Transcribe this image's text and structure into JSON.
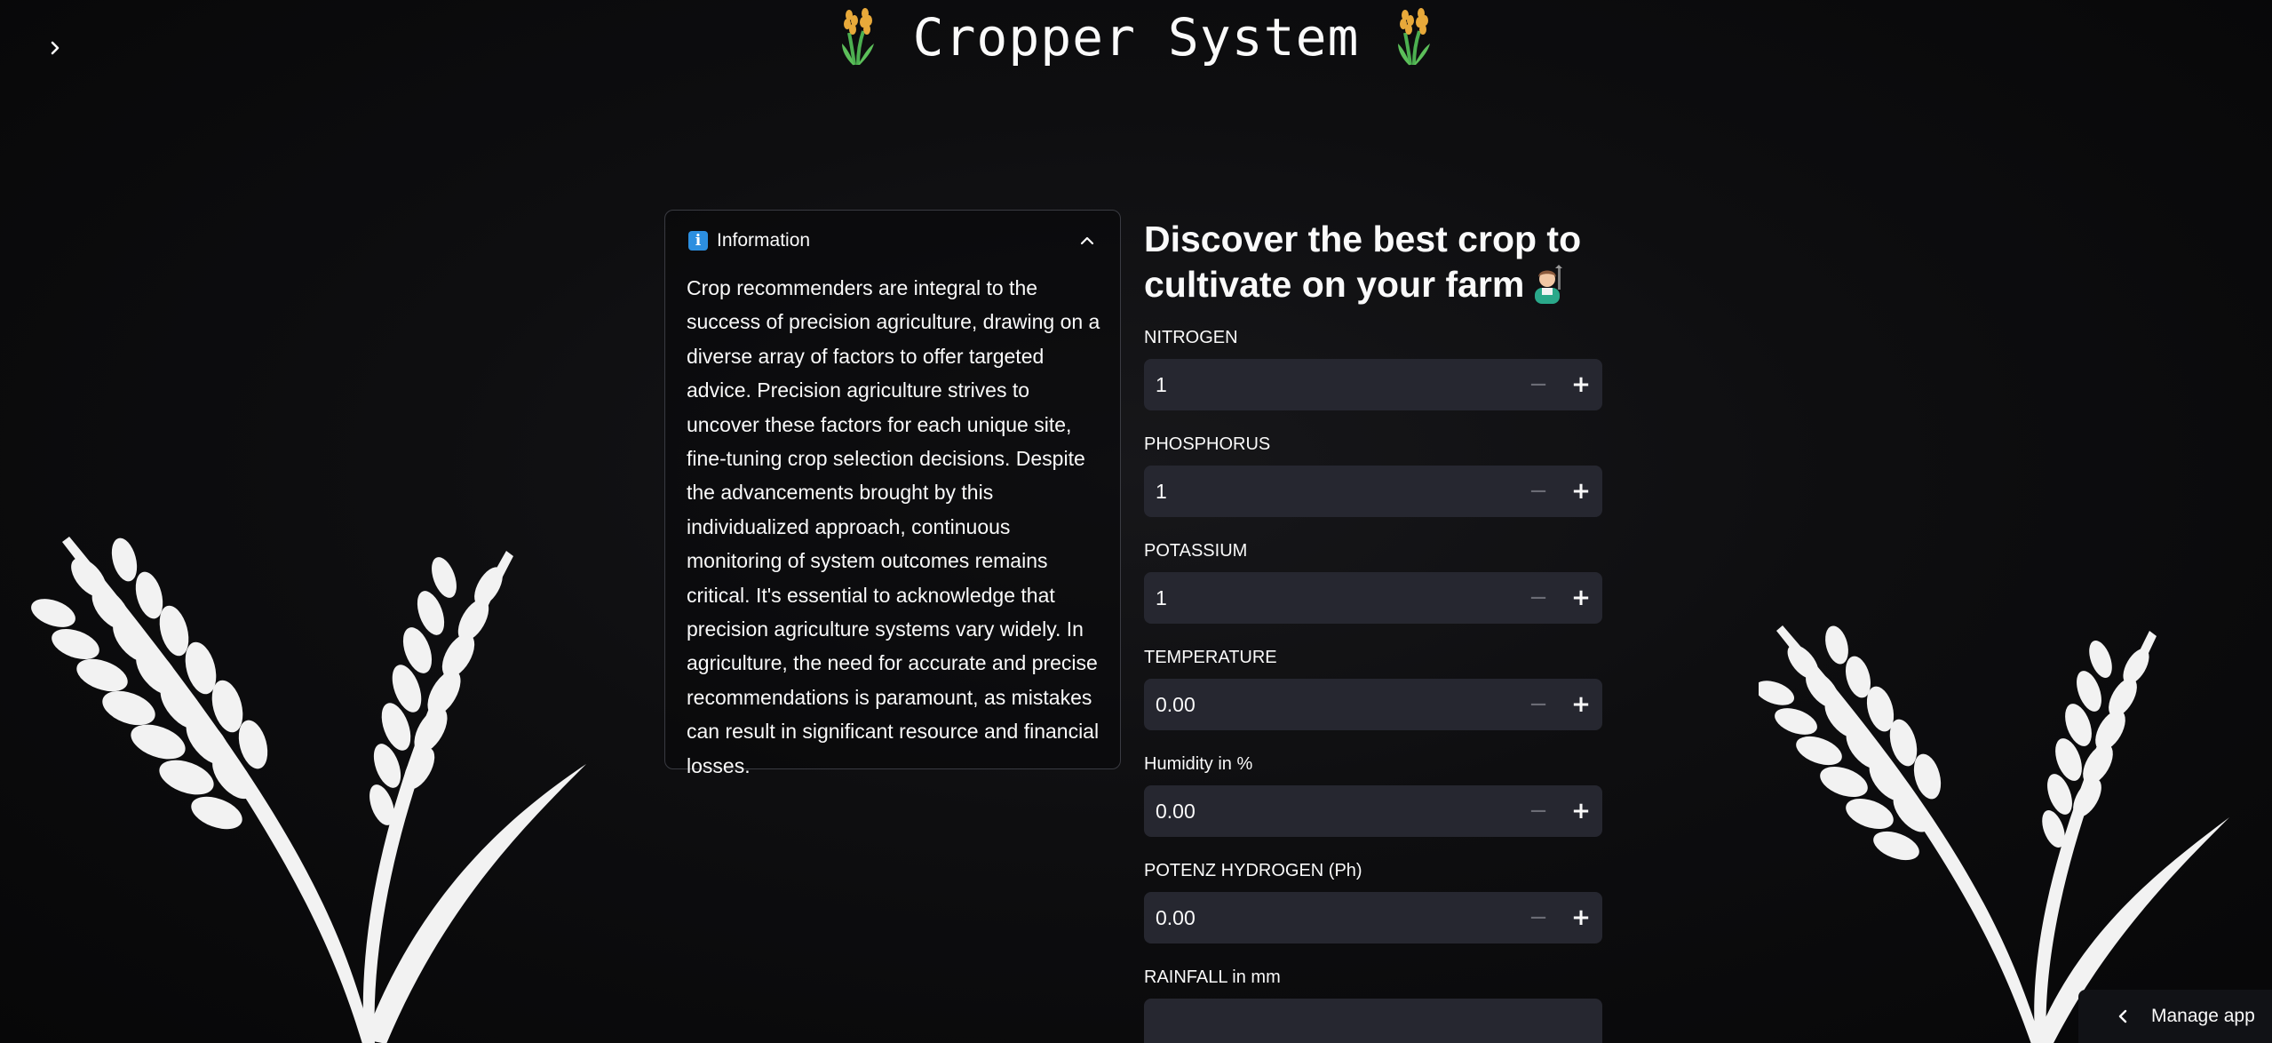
{
  "app": {
    "title": "Cropper System",
    "title_icon": "sheaf-of-rice-emoji",
    "sidebar_toggle_icon": "chevron-right-icon"
  },
  "info_panel": {
    "title": "Information",
    "icon": "information-icon",
    "collapse_icon": "chevron-up-icon",
    "body": "Crop recommenders are integral to the success of precision agriculture, drawing on a diverse array of factors to offer targeted advice. Precision agriculture strives to uncover these factors for each unique site, fine-tuning crop selection decisions. Despite the advancements brought by this individualized approach, continuous monitoring of system outcomes remains critical. It's essential to acknowledge that precision agriculture systems vary widely. In agriculture, the need for accurate and precise recommendations is paramount, as mistakes can result in significant resource and financial losses."
  },
  "form": {
    "heading": "Discover the best crop to cultivate on your farm",
    "heading_icon": "farmer-emoji",
    "fields": [
      {
        "label": "NITROGEN",
        "value": "1"
      },
      {
        "label": "PHOSPHORUS",
        "value": "1"
      },
      {
        "label": "POTASSIUM",
        "value": "1"
      },
      {
        "label": "TEMPERATURE",
        "value": "0.00"
      },
      {
        "label": "Humidity in %",
        "value": "0.00"
      },
      {
        "label": "POTENZ HYDROGEN (Ph)",
        "value": "0.00"
      },
      {
        "label": "RAINFALL in mm",
        "value": ""
      }
    ],
    "stepper_minus": "−",
    "stepper_plus": "+"
  },
  "footer": {
    "manage_app_label": "Manage app",
    "manage_app_icon": "chevron-left-icon"
  },
  "colors": {
    "background": "#0e0e10",
    "input_background": "#262730",
    "text": "#fafafa",
    "info_icon": "#2c8fe0",
    "border": "#3a3b42"
  }
}
